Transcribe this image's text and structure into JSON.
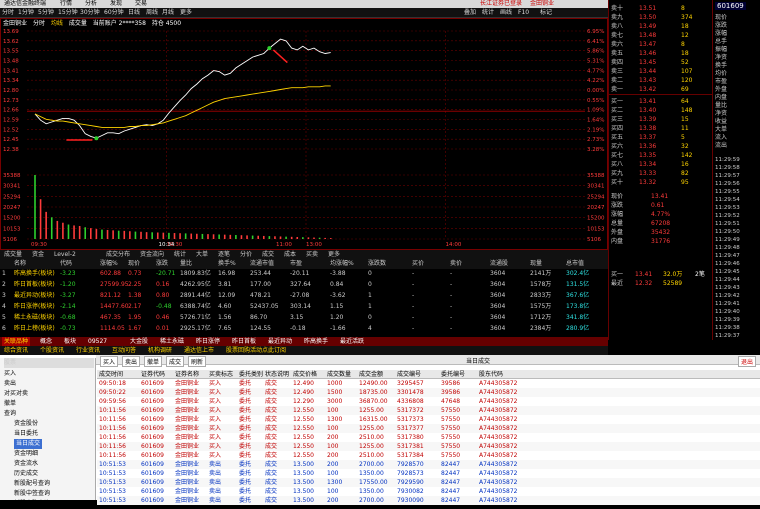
{
  "menubar": {
    "items": [
      "行情",
      "分析",
      "发现",
      "交易"
    ],
    "broker": "通达信金融终端",
    "right_a": "长江证券已登录",
    "right_b": "金田铜业"
  },
  "chart_toolbar": {
    "stock": "金田铜业",
    "period_items": [
      "分时",
      "1分钟",
      "5分钟",
      "15分钟",
      "30分钟",
      "60分钟",
      "日线",
      "周线",
      "月线",
      "更多"
    ],
    "right_items": [
      "叠加",
      "统计",
      "画线",
      "F10",
      "标记",
      "—"
    ]
  },
  "status_line": {
    "stock": "金田铜业",
    "mode": "分时",
    "label": "均线",
    "flow": "成交量",
    "account": "普通账户",
    "position": "当前账户 2****358",
    "hold": "持仓 4500"
  },
  "chart_data": {
    "type": "line",
    "title": "",
    "y_ticks": [
      "13.69",
      "13.62",
      "13.55",
      "13.48",
      "13.41",
      "13.34",
      "12.80",
      "12.73",
      "12.66",
      "12.59",
      "12.52",
      "12.45",
      "12.38"
    ],
    "y_ticks_right": [
      "6.95%",
      "6.41%",
      "5.86%",
      "5.31%",
      "4.77%",
      "4.22%",
      "0.00%",
      "0.55%",
      "1.09%",
      "1.64%",
      "2.19%",
      "2.73%",
      "3.28%"
    ],
    "vol_ticks": [
      "35388",
      "30341",
      "25294",
      "20247",
      "15200",
      "10153",
      "5106"
    ],
    "vol_ticks_right": [
      "35388",
      "30341",
      "25294",
      "20247",
      "15200",
      "10153",
      "5106"
    ],
    "x_ticks": [
      "09:30",
      "10:30",
      "11:00",
      "13:00",
      "14:00"
    ],
    "price_series": [
      12.77,
      12.7,
      12.66,
      12.68,
      12.7,
      12.72,
      12.72,
      12.7,
      12.64,
      12.55,
      12.52,
      12.5,
      12.53,
      12.56,
      12.56,
      12.55,
      12.58,
      12.6,
      12.62,
      12.64,
      12.65,
      12.64,
      12.66,
      12.7,
      12.78,
      12.85,
      12.92,
      12.98,
      13.05,
      13.1,
      13.16,
      13.2,
      13.25,
      13.24,
      13.2,
      13.22,
      13.28,
      13.32,
      13.36,
      13.4,
      13.42,
      13.44,
      13.5,
      13.55,
      13.6,
      13.58,
      13.5,
      13.48,
      13.52,
      13.48,
      13.5,
      13.46,
      13.44,
      13.45
    ],
    "avg_series": [
      12.77,
      12.74,
      12.71,
      12.7,
      12.69,
      12.69,
      12.68,
      12.67,
      12.66,
      12.65,
      12.64,
      12.63,
      12.62,
      12.62,
      12.62,
      12.62,
      12.62,
      12.63,
      12.63,
      12.64,
      12.64,
      12.65,
      12.66,
      12.67,
      12.69,
      12.71,
      12.73,
      12.75,
      12.78,
      12.81,
      12.84,
      12.87,
      12.9,
      12.92,
      12.94,
      12.95,
      12.96,
      12.97,
      12.98,
      12.99,
      13.0,
      13.01,
      13.02,
      13.03,
      13.04,
      13.05,
      13.06,
      13.06,
      13.06,
      13.07,
      13.07,
      13.07,
      13.08,
      13.08
    ],
    "volume_series": [
      35388,
      22000,
      15000,
      12000,
      10000,
      9000,
      8000,
      7500,
      7200,
      6500,
      6000,
      5500,
      5200,
      5000,
      4800,
      4600,
      4500,
      4300,
      4100,
      4000,
      3800,
      3700,
      3600,
      3500,
      3400,
      3300,
      3200,
      3100,
      3000,
      2900,
      2800,
      2700,
      2600,
      2500,
      2400,
      2300,
      2200,
      2100,
      2000,
      1900,
      1800,
      1700,
      1600,
      1500,
      1400,
      1300,
      1200,
      1100,
      1000,
      900,
      800,
      700,
      600,
      500
    ],
    "ylim": [
      12.38,
      13.69
    ],
    "prev_close": 12.8,
    "grid": true
  },
  "chart_labels": {
    "time_marker": "10:34"
  },
  "tabs_mid": [
    "成交量",
    "资金",
    "Level-2",
    "成交分布",
    "资金流向",
    "统计",
    "大单",
    "逐笔",
    "分价",
    "成交",
    "成本",
    "买卖",
    "更多"
  ],
  "table": {
    "headers": [
      "名称",
      "代码",
      "涨幅%",
      "现价",
      "涨跌",
      "量比",
      "换手%",
      "流通市值",
      "市盈",
      "均涨幅%",
      "涨跌数",
      "买价",
      "卖价",
      "流通股",
      "现量",
      "总市值"
    ],
    "rows": [
      {
        "idx": "1",
        "name": "昨高换手",
        "tag": "(板块)",
        "c1": "-3.23",
        "c2": "602.88",
        "c3": "0.73",
        "c4": "-20.71",
        "c5": "1809.83亿",
        "c6": "16.98",
        "c7": "253.44",
        "c8": "-20.11",
        "c9": "-3.88",
        "c10": "0",
        "c11": "-",
        "c12": "-",
        "c13": "3604",
        "c14": "-",
        "c15": "2141万",
        "c16": "302.4亿"
      },
      {
        "idx": "2",
        "name": "昨日首板",
        "tag": "(板块)",
        "c1": "-1.20",
        "c2": "27599.95",
        "c3": "2.25",
        "c4": "0.16",
        "c5": "4262.95亿",
        "c6": "3.81",
        "c7": "177.00",
        "c8": "327.64",
        "c9": "0.84",
        "c10": "0",
        "c11": "-",
        "c12": "-",
        "c13": "3604",
        "c14": "-",
        "c15": "1578万",
        "c16": "131.5亿"
      },
      {
        "idx": "3",
        "name": "最近异动",
        "tag": "(板块)",
        "c1": "-3.27",
        "c2": "821.12",
        "c3": "1.38",
        "c4": "0.80",
        "c5": "2891.44亿",
        "c6": "12.09",
        "c7": "478.21",
        "c8": "-27.08",
        "c9": "-3.62",
        "c10": "1",
        "c11": "-",
        "c12": "-",
        "c13": "3604",
        "c14": "-",
        "c15": "2833万",
        "c16": "367.6亿"
      },
      {
        "idx": "4",
        "name": "昨日涨停",
        "tag": "(板块)",
        "c1": "-2.14",
        "c2": "14477.60",
        "c3": "2.17",
        "c4": "-0.48",
        "c5": "6388.74亿",
        "c6": "4.60",
        "c7": "52437.05",
        "c8": "303.14",
        "c9": "1.15",
        "c10": "1",
        "c11": "-",
        "c12": "-",
        "c13": "3604",
        "c14": "-",
        "c15": "1575万",
        "c16": "173.8亿"
      },
      {
        "idx": "5",
        "name": "稀土永磁",
        "tag": "(板块)",
        "c1": "-0.68",
        "c2": "467.35",
        "c3": "1.95",
        "c4": "0.46",
        "c5": "5726.71亿",
        "c6": "1.56",
        "c7": "86.70",
        "c8": "3.15",
        "c9": "1.20",
        "c10": "0",
        "c11": "-",
        "c12": "-",
        "c13": "3604",
        "c14": "-",
        "c15": "1712万",
        "c16": "341.8亿"
      },
      {
        "idx": "6",
        "name": "昨日上榜",
        "tag": "(板块)",
        "c1": "-0.73",
        "c2": "1114.05",
        "c3": "1.67",
        "c4": "0.01",
        "c5": "2925.17亿",
        "c6": "7.65",
        "c7": "124.55",
        "c8": "-0.18",
        "c9": "-1.66",
        "c10": "4",
        "c11": "-",
        "c12": "-",
        "c13": "3604",
        "c14": "-",
        "c15": "2384万",
        "c16": "280.9亿"
      }
    ]
  },
  "bottom_tabs_red": [
    "关联品种",
    "概念",
    "板块",
    "09527",
    "大金股",
    "稀土永磁",
    "昨日涨停",
    "昨日首板",
    "最近异动",
    "昨高换手",
    "最近活跃"
  ],
  "bottom_news": [
    "综合资讯",
    "个股资讯",
    "行业资讯",
    "互动问答",
    "机构调研",
    "通达信上市",
    "股票回购活动点此订阅"
  ],
  "right_panel": {
    "sell_rows": [
      {
        "label": "卖十",
        "price": "13.51",
        "vol": "8"
      },
      {
        "label": "卖九",
        "price": "13.50",
        "vol": "374"
      },
      {
        "label": "卖八",
        "price": "13.49",
        "vol": "18"
      },
      {
        "label": "卖七",
        "price": "13.48",
        "vol": "12"
      },
      {
        "label": "卖六",
        "price": "13.47",
        "vol": "8"
      },
      {
        "label": "卖五",
        "price": "13.46",
        "vol": "18"
      },
      {
        "label": "卖四",
        "price": "13.45",
        "vol": "52"
      },
      {
        "label": "卖三",
        "price": "13.44",
        "vol": "107"
      },
      {
        "label": "卖二",
        "price": "13.43",
        "vol": "120"
      },
      {
        "label": "卖一",
        "price": "13.42",
        "vol": "69"
      }
    ],
    "buy_rows": [
      {
        "label": "买一",
        "price": "13.41",
        "vol": "64"
      },
      {
        "label": "买二",
        "price": "13.40",
        "vol": "148"
      },
      {
        "label": "买三",
        "price": "13.39",
        "vol": "15"
      },
      {
        "label": "买四",
        "price": "13.38",
        "vol": "11"
      },
      {
        "label": "买五",
        "price": "13.37",
        "vol": "5"
      },
      {
        "label": "买六",
        "price": "13.36",
        "vol": "32"
      },
      {
        "label": "买七",
        "price": "13.35",
        "vol": "142"
      },
      {
        "label": "买八",
        "price": "13.34",
        "vol": "16"
      },
      {
        "label": "买九",
        "price": "13.33",
        "vol": "82"
      },
      {
        "label": "买十",
        "price": "13.32",
        "vol": "95"
      }
    ],
    "stats": [
      {
        "k": "现价",
        "v": "13.41"
      },
      {
        "k": "涨跌",
        "v": "0.61"
      },
      {
        "k": "涨幅",
        "v": "4.77%"
      },
      {
        "k": "总量",
        "v": "67208"
      },
      {
        "k": "外盘",
        "v": "35432"
      },
      {
        "k": "内盘",
        "v": "31776"
      }
    ],
    "bottom_rows": [
      {
        "label": "买一",
        "price": "13.41",
        "vol": "32.0万",
        "extra": "2笔"
      },
      {
        "label": "最近",
        "price": "12.32",
        "vol": "52589",
        "extra": ""
      }
    ]
  },
  "far_right": {
    "code": "601609",
    "labels": [
      "现价",
      "涨跌",
      "涨幅",
      "总手",
      "振幅",
      "净资",
      "换手",
      "均价",
      "市盈",
      "外盘",
      "内盘",
      "量比",
      "净资",
      "收益",
      "大单",
      "流入",
      "流出"
    ],
    "times": [
      "11:29:59",
      "11:29:58",
      "11:29:57",
      "11:29:56",
      "11:29:55",
      "11:29:54",
      "11:29:53",
      "11:29:52",
      "11:29:51",
      "11:29:50",
      "11:29:49",
      "11:29:48",
      "11:29:47",
      "11:29:46",
      "11:29:45",
      "11:29:44",
      "11:29:43",
      "11:29:42",
      "11:29:41",
      "11:29:40",
      "11:29:39",
      "11:29:38",
      "11:29:37"
    ]
  },
  "bottom_toolbar": {
    "items": [
      "买入",
      "卖出",
      "撤单",
      "成交",
      "刷新"
    ],
    "title": "当日成交",
    "right": "退出"
  },
  "sidebar": {
    "header": "股票",
    "items": [
      "买入",
      "卖出",
      "对买对卖",
      "撤单",
      "查询",
      "资金股份",
      "当日委托",
      "当日成交",
      "资金明细",
      "资金流水",
      "历史成交",
      "新股配号查询",
      "新股中签查询",
      "新股申购查询"
    ]
  },
  "trade_table": {
    "headers": [
      "成交时间",
      "证券代码",
      "证券名称",
      "买卖标志",
      "委托类别",
      "状态说明",
      "成交价格",
      "成交数量",
      "成交金额",
      "成交编号",
      "委托编号",
      "股东代码"
    ],
    "rows": [
      [
        "09:50:18",
        "601609",
        "金田铜业",
        "买入",
        "委托",
        "成交",
        "12.490",
        "1000",
        "12490.00",
        "3295457",
        "39586",
        "A744305872"
      ],
      [
        "09:50:22",
        "601609",
        "金田铜业",
        "买入",
        "委托",
        "成交",
        "12.490",
        "1500",
        "18735.00",
        "3301478",
        "39586",
        "A744305872"
      ],
      [
        "09:59:56",
        "601609",
        "金田铜业",
        "买入",
        "委托",
        "成交",
        "12.290",
        "3000",
        "36870.00",
        "4336808",
        "47648",
        "A744305872"
      ],
      [
        "10:11:56",
        "601609",
        "金田铜业",
        "买入",
        "委托",
        "成交",
        "12.550",
        "100",
        "1255.00",
        "5317372",
        "57550",
        "A744305872"
      ],
      [
        "10:11:56",
        "601609",
        "金田铜业",
        "买入",
        "委托",
        "成交",
        "12.550",
        "1300",
        "16315.00",
        "5317373",
        "57550",
        "A744305872"
      ],
      [
        "10:11:56",
        "601609",
        "金田铜业",
        "买入",
        "委托",
        "成交",
        "12.550",
        "100",
        "1255.00",
        "5317377",
        "57550",
        "A744305872"
      ],
      [
        "10:11:56",
        "601609",
        "金田铜业",
        "买入",
        "委托",
        "成交",
        "12.550",
        "200",
        "2510.00",
        "5317380",
        "57550",
        "A744305872"
      ],
      [
        "10:11:56",
        "601609",
        "金田铜业",
        "买入",
        "委托",
        "成交",
        "12.550",
        "100",
        "1255.00",
        "5317381",
        "57550",
        "A744305872"
      ],
      [
        "10:11:56",
        "601609",
        "金田铜业",
        "买入",
        "委托",
        "成交",
        "12.550",
        "200",
        "2510.00",
        "5317384",
        "57550",
        "A744305872"
      ],
      [
        "10:51:53",
        "601609",
        "金田铜业",
        "卖出",
        "委托",
        "成交",
        "13.500",
        "200",
        "2700.00",
        "7928570",
        "82447",
        "A744305872"
      ],
      [
        "10:51:53",
        "601609",
        "金田铜业",
        "卖出",
        "委托",
        "成交",
        "13.500",
        "100",
        "1350.00",
        "7928573",
        "82447",
        "A744305872"
      ],
      [
        "10:51:53",
        "601609",
        "金田铜业",
        "卖出",
        "委托",
        "成交",
        "13.500",
        "1300",
        "17550.00",
        "7929590",
        "82447",
        "A744305872"
      ],
      [
        "10:51:53",
        "601609",
        "金田铜业",
        "卖出",
        "委托",
        "成交",
        "13.500",
        "100",
        "1350.00",
        "7930082",
        "82447",
        "A744305872"
      ],
      [
        "10:51:53",
        "601609",
        "金田铜业",
        "卖出",
        "委托",
        "成交",
        "13.500",
        "200",
        "2700.00",
        "7930090",
        "82447",
        "A744305872"
      ]
    ]
  }
}
